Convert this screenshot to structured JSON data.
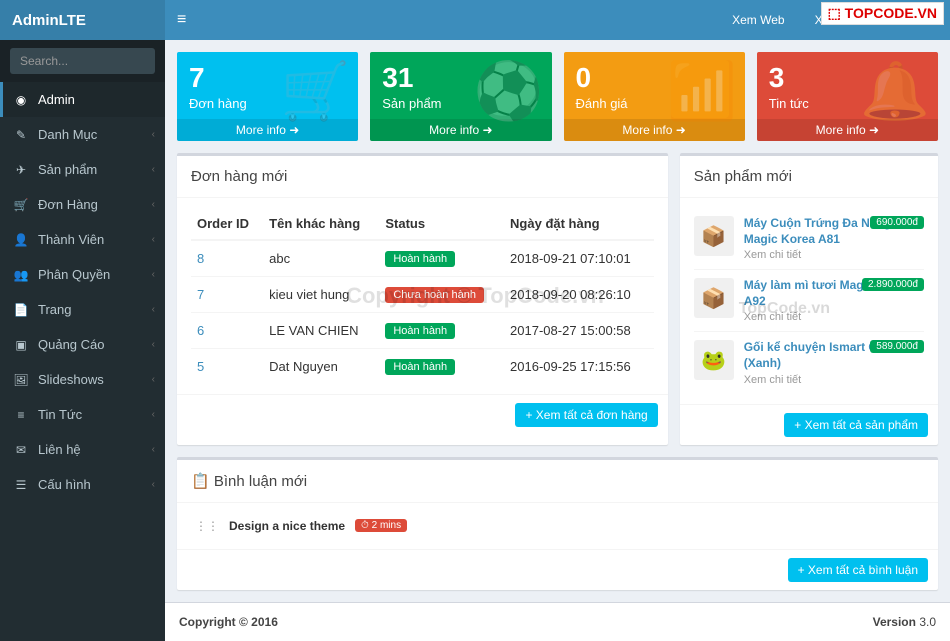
{
  "brand": "AdminLTE",
  "search": {
    "placeholder": "Search..."
  },
  "nav": [
    {
      "icon": "◉",
      "label": "Admin",
      "active": true,
      "chev": false
    },
    {
      "icon": "✎",
      "label": "Danh Mục",
      "chev": true
    },
    {
      "icon": "✈",
      "label": "Sản phẩm",
      "chev": true
    },
    {
      "icon": "🛒",
      "label": "Đơn Hàng",
      "chev": true
    },
    {
      "icon": "👤",
      "label": "Thành Viên",
      "chev": true
    },
    {
      "icon": "👥",
      "label": "Phân Quyền",
      "chev": true
    },
    {
      "icon": "📄",
      "label": "Trang",
      "chev": true
    },
    {
      "icon": "▣",
      "label": "Quảng Cáo",
      "chev": true
    },
    {
      "icon": "🖼",
      "label": "Slideshows",
      "chev": true
    },
    {
      "icon": "≡",
      "label": "Tin Tức",
      "chev": true
    },
    {
      "icon": "✉",
      "label": "Liên hệ",
      "chev": true
    },
    {
      "icon": "☰",
      "label": "Cấu hình",
      "chev": true
    }
  ],
  "header": {
    "xem_web": "Xem Web",
    "greeting": "Xin chào: Administrator"
  },
  "boxes": [
    {
      "num": "7",
      "label": "Đơn hàng",
      "more": "More info ➜",
      "color": "bg-aqua",
      "icon": "🛒"
    },
    {
      "num": "31",
      "label": "Sản phẩm",
      "more": "More info ➜",
      "color": "bg-green",
      "icon": "⚽"
    },
    {
      "num": "0",
      "label": "Đánh giá",
      "more": "More info ➜",
      "color": "bg-yellow",
      "icon": "📶"
    },
    {
      "num": "3",
      "label": "Tin tức",
      "more": "More info ➜",
      "color": "bg-red",
      "icon": "🔔"
    }
  ],
  "orders": {
    "title": "Đơn hàng mới",
    "headers": {
      "id": "Order ID",
      "name": "Tên khác hàng",
      "status": "Status",
      "date": "Ngày đặt hàng"
    },
    "rows": [
      {
        "id": "8",
        "name": "abc",
        "status": "Hoàn hành",
        "cls": "bg-success",
        "date": "2018-09-21 07:10:01"
      },
      {
        "id": "7",
        "name": "kieu viet hung",
        "status": "Chưa hoàn hành",
        "cls": "bg-danger",
        "date": "2018-09-20 08:26:10"
      },
      {
        "id": "6",
        "name": "LE VAN CHIEN",
        "status": "Hoàn hành",
        "cls": "bg-success",
        "date": "2017-08-27 15:00:58"
      },
      {
        "id": "5",
        "name": "Dat Nguyen",
        "status": "Hoàn hành",
        "cls": "bg-success",
        "date": "2016-09-25 17:15:56"
      }
    ],
    "btn": "+ Xem tất cả đơn hàng"
  },
  "products": {
    "title": "Sản phẩm mới",
    "items": [
      {
        "name": "Máy Cuộn Trứng Đa Năng Magic Korea A81",
        "sub": "Xem chi tiết",
        "price": "690.000đ",
        "emoji": "📦"
      },
      {
        "name": "Máy làm mì tươi Magic Korea A92",
        "sub": "Xem chi tiết",
        "price": "2.890.000đ",
        "emoji": "📦"
      },
      {
        "name": "Gối kể chuyện Ismart G15 (Xanh)",
        "sub": "Xem chi tiết",
        "price": "589.000đ",
        "emoji": "🐸"
      }
    ],
    "btn": "+ Xem tất cả sản phẩm"
  },
  "comments": {
    "title": "Bình luận mới",
    "icon": "📋",
    "items": [
      {
        "text": "Design a nice theme",
        "time": "⏱ 2 mins"
      }
    ],
    "btn": "+ Xem tất cả bình luận"
  },
  "footer": {
    "left": "Copyright © 2016",
    "right_label": "Version",
    "right_val": "3.0"
  },
  "watermark": "Copyright © TopCode.vn",
  "watermark2": "⬚ TOPCODE.VN",
  "watermark3": "TopCode.vn"
}
